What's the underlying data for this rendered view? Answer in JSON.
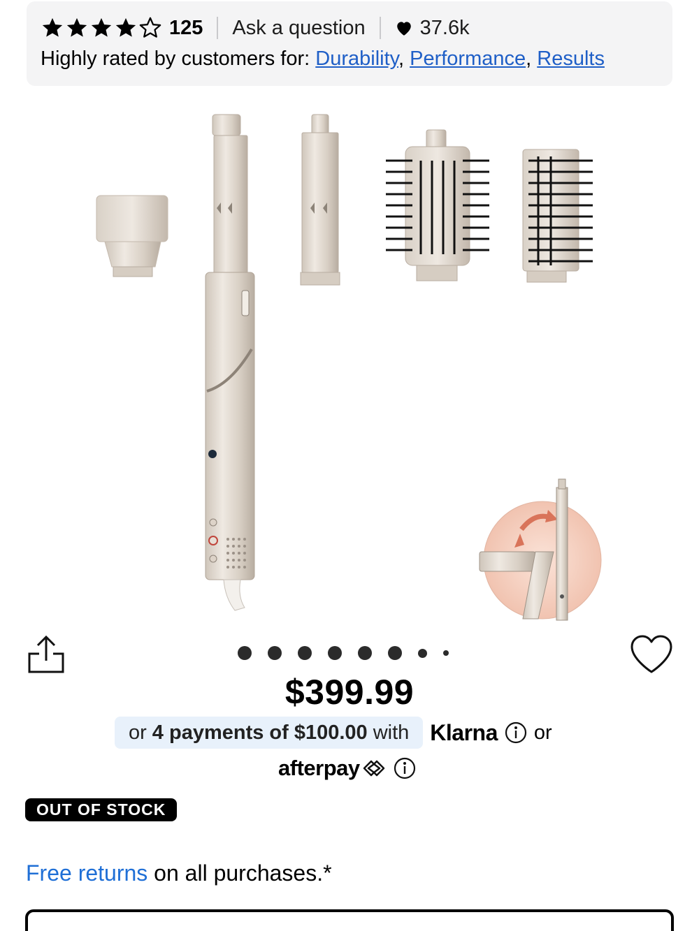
{
  "rating": {
    "stars": 4.5,
    "review_count": "125",
    "ask_label": "Ask a question",
    "likes": "37.6k",
    "rated_prefix": "Highly rated by customers for:",
    "tags": [
      "Durability",
      "Performance",
      "Results"
    ]
  },
  "gallery": {
    "image_alt": "Shark styler with attachments",
    "dots_total": 8,
    "active_index": 0
  },
  "pricing": {
    "price": "$399.99",
    "pay_prefix": "or",
    "pay_bold": "4 payments of $100.00",
    "pay_with": "with",
    "klarna": "Klarna",
    "or2": "or",
    "afterpay": "afterpay"
  },
  "stock": {
    "badge": "OUT OF STOCK"
  },
  "returns": {
    "link": "Free returns",
    "rest": " on all purchases.*"
  },
  "colors": {
    "link": "#1f5fc7",
    "pill": "#e8f1fb",
    "badge": "#000000"
  }
}
